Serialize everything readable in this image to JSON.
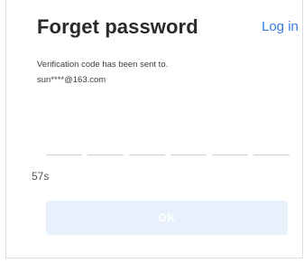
{
  "header": {
    "title": "Forget password",
    "login_link": "Log in"
  },
  "message": {
    "line1": "Verification code has been sent to.",
    "email": "sun****@163.com"
  },
  "code_input": {
    "slot_count": 6,
    "values": [
      "",
      "",
      "",
      "",
      "",
      ""
    ]
  },
  "countdown": {
    "text": "57s"
  },
  "actions": {
    "ok_label": "OK",
    "ok_enabled": false
  },
  "colors": {
    "link": "#3a7be8",
    "button_disabled_bg": "#e7f0fb"
  }
}
